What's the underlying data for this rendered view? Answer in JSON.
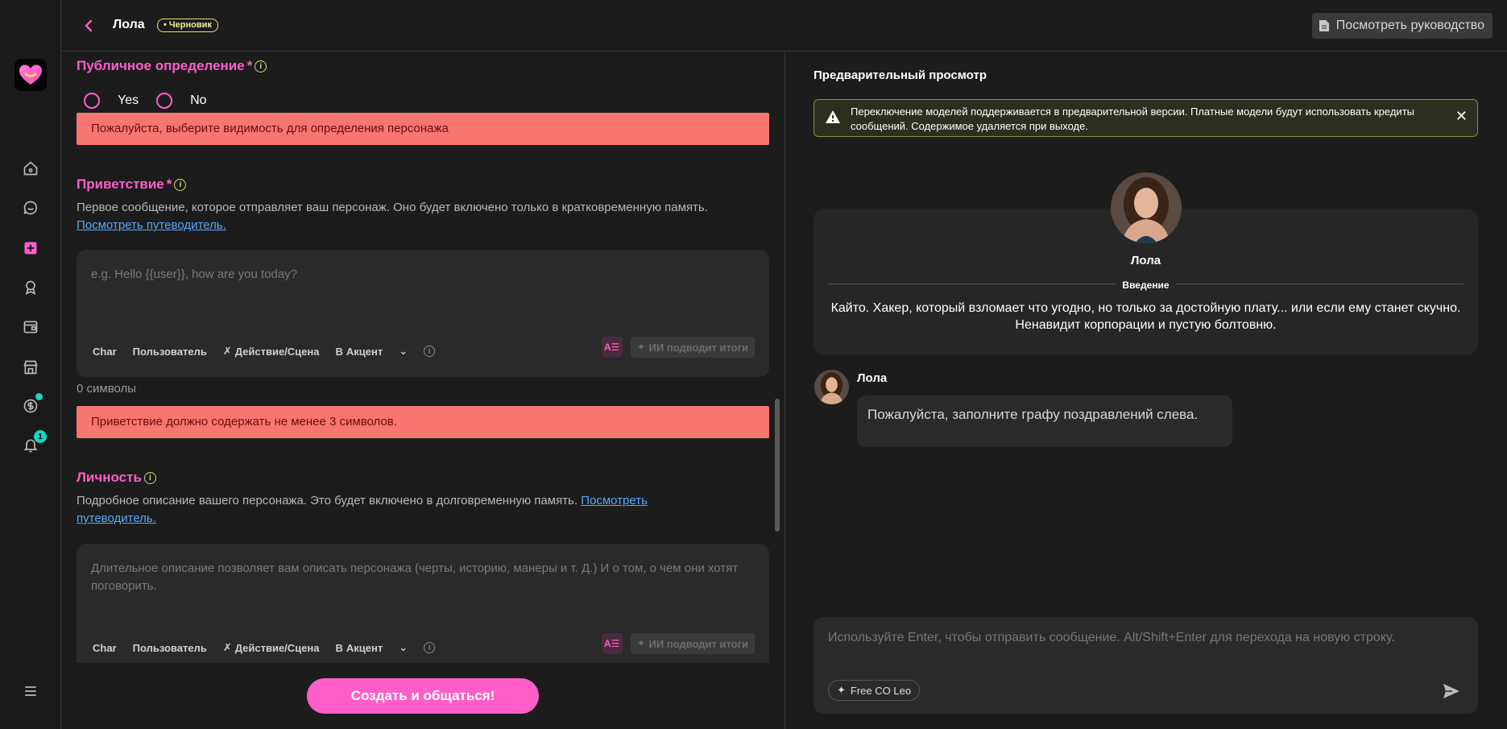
{
  "header": {
    "title": "Лола",
    "draft_label": "• Черновик",
    "guide_button": "Посмотреть руководство"
  },
  "sidebar": {
    "items": [
      {
        "icon": "home-icon"
      },
      {
        "icon": "chat-icon"
      },
      {
        "icon": "create-icon"
      },
      {
        "icon": "award-icon"
      },
      {
        "icon": "wallet-icon"
      },
      {
        "icon": "store-icon"
      },
      {
        "icon": "coin-icon"
      },
      {
        "icon": "bell-icon",
        "badge": "1"
      },
      {
        "icon": "menu-icon"
      }
    ]
  },
  "form": {
    "public_definition": {
      "title": "Публичное определение",
      "required_mark": "*",
      "options": [
        "Yes",
        "No"
      ],
      "error": "Пожалуйста, выберите видимость для определения персонажа"
    },
    "greeting": {
      "title": "Приветствие",
      "required_mark": "*",
      "description": "Первое сообщение, которое отправляет ваш персонаж. Оно будет включено только в кратковременную память.",
      "guide_link": "Посмотреть путеводитель.",
      "placeholder": "e.g. Hello {{user}}, how are you today?",
      "char_count": "0 символы",
      "error": "Приветствие должно содержать не менее 3 символов."
    },
    "personality": {
      "title": "Личность",
      "description": "Подробное описание вашего персонажа. Это будет включено в долговременную память.",
      "guide_link": "Посмотреть путеводитель.",
      "placeholder": "Длительное описание позволяет вам описать персонажа (черты, историю, манеры и т. Д.) И о том, о чем они хотят поговорить."
    },
    "toolbar": {
      "char": "Char",
      "user": "Пользователь",
      "action": "Действие/Сцена",
      "accent": "Акцент",
      "ai_summary": "ИИ подводит итоги"
    },
    "create_button": "Создать и общаться!"
  },
  "preview": {
    "title": "Предварительный просмотр",
    "warning": "Переключение моделей поддерживается в предварительной версии. Платные модели будут использовать кредиты сообщений. Содержимое удаляется при выходе.",
    "character_name": "Лола",
    "intro_label": "Введение",
    "intro_text": "Кайто. Хакер, который взломает что угодно, но только за достойную плату... или если ему станет скучно. Ненавидит корпорации и пустую болтовню.",
    "message_author": "Лола",
    "message_text": "Пожалуйста, заполните графу поздравлений слева.",
    "input_placeholder": "Используйте Enter, чтобы отправить сообщение. Alt/Shift+Enter для перехода на новую строку.",
    "model_chip": "Free CO Leo"
  },
  "colors": {
    "accent": "#ff5ec8",
    "error_bg": "#f7766f",
    "teal_badge": "#19d3c5",
    "info_icon": "#cbe46a"
  }
}
